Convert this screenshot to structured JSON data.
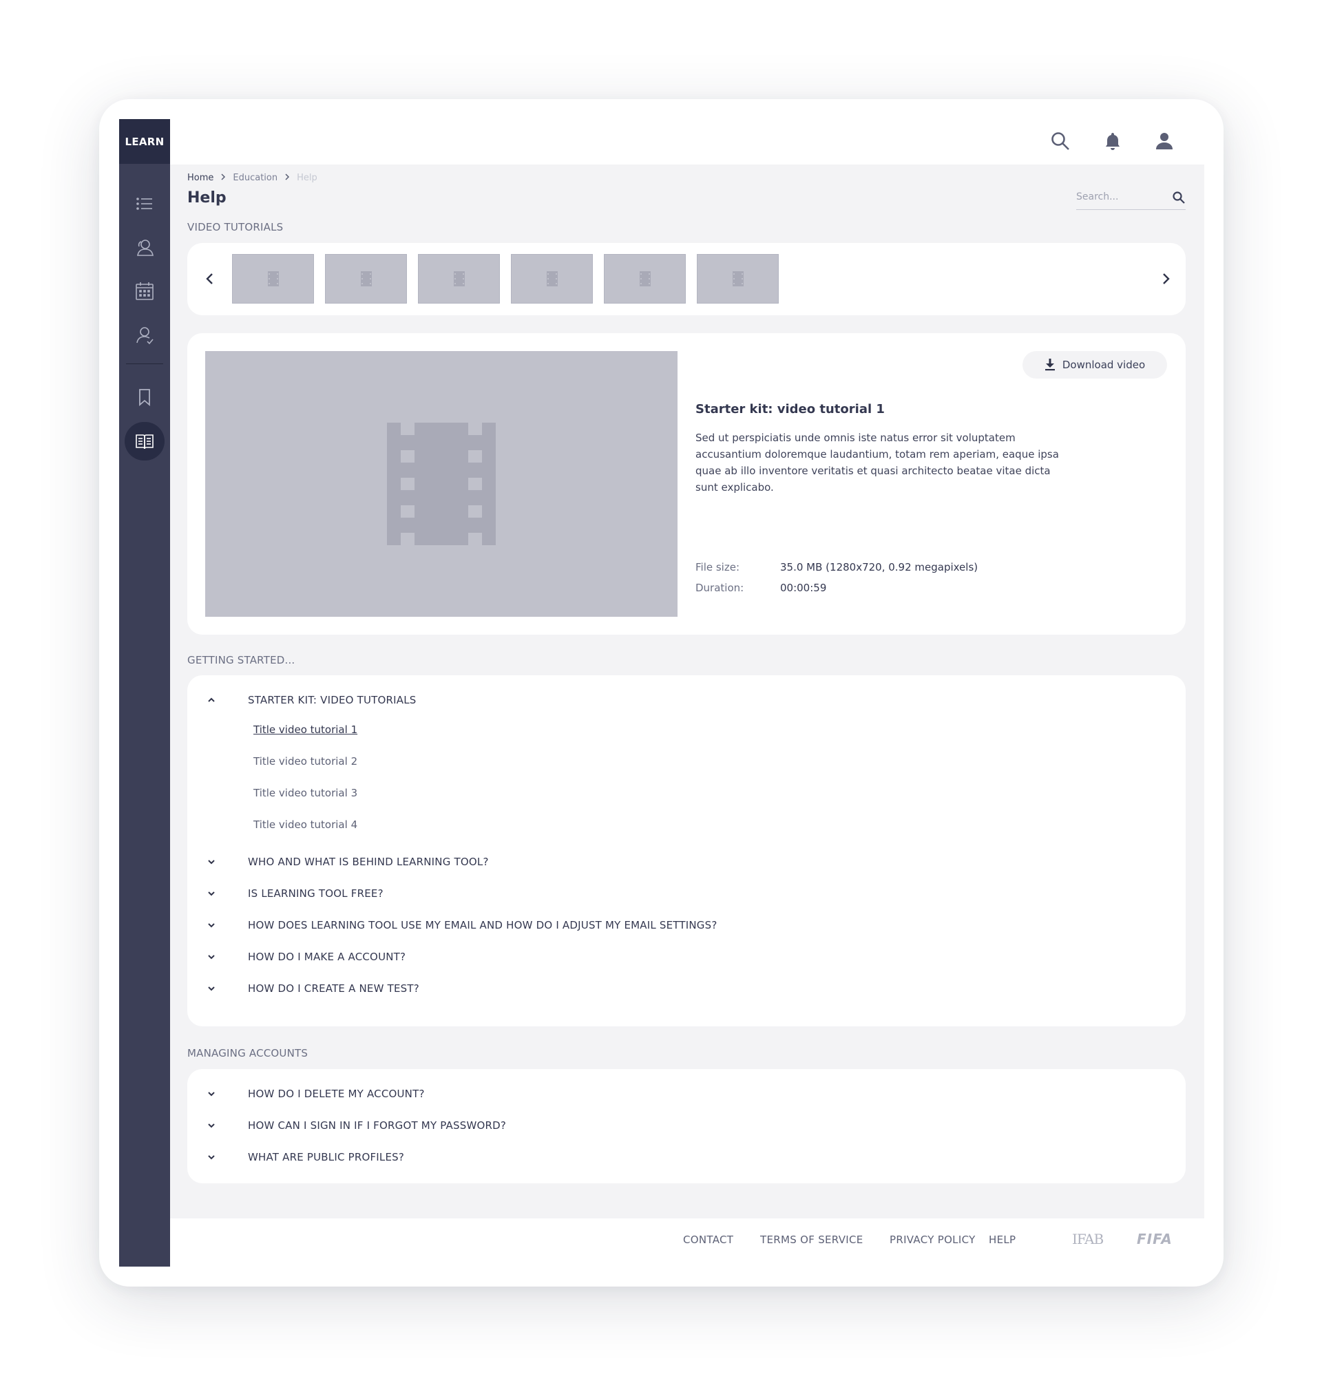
{
  "app": {
    "brand": "LEARN"
  },
  "sidebar": {
    "icons": [
      "list-icon",
      "users-icon",
      "calendar-icon",
      "user-icon",
      "bookmark-icon",
      "book-icon"
    ],
    "active": "book-icon"
  },
  "topbar": {
    "icons": [
      "search-icon",
      "bell-icon",
      "profile-icon"
    ]
  },
  "breadcrumb": {
    "items": [
      "Home",
      "Education",
      "Help"
    ]
  },
  "page": {
    "title": "Help"
  },
  "search": {
    "placeholder": "Search..."
  },
  "video_tutorials": {
    "label": "VIDEO TUTORIALS",
    "thumbnail_count": 6
  },
  "video": {
    "download_label": "Download video",
    "title": "Starter kit: video tutorial 1",
    "description": "Sed ut perspiciatis unde omnis iste natus error sit voluptatem accusantium doloremque laudantium, totam rem aperiam, eaque ipsa quae ab illo inventore veritatis et quasi architecto beatae vitae dicta sunt explicabo.",
    "file_size_label": "File size:",
    "file_size": "35.0 MB (1280x720, 0.92 megapixels)",
    "duration_label": "Duration:",
    "duration": "00:00:59"
  },
  "getting_started": {
    "label": "GETTING STARTED...",
    "expanded": {
      "title": "STARTER KIT: VIDEO TUTORIALS",
      "items": [
        "Title video tutorial 1",
        "Title video tutorial 2",
        "Title video tutorial 3",
        "Title video tutorial 4"
      ]
    },
    "questions": [
      "WHO AND WHAT IS BEHIND LEARNING TOOL?",
      "IS LEARNING TOOL FREE?",
      "HOW DOES LEARNING TOOL USE MY EMAIL AND HOW DO I ADJUST MY EMAIL SETTINGS?",
      "HOW DO I MAKE A ACCOUNT?",
      "HOW DO I CREATE A NEW TEST?"
    ]
  },
  "managing_accounts": {
    "label": "MANAGING ACCOUNTS",
    "questions": [
      "HOW DO I DELETE MY ACCOUNT?",
      "HOW CAN I SIGN IN IF I FORGOT MY PASSWORD?",
      "WHAT ARE PUBLIC PROFILES?"
    ]
  },
  "footer": {
    "links": [
      "CONTACT",
      "TERMS OF SERVICE",
      "PRIVACY POLICY",
      "HELP"
    ],
    "logos": [
      "IFAB",
      "FIFA"
    ]
  },
  "colors": {
    "sidebar": "#3c3f57",
    "sidebar_dark": "#282c44",
    "background": "#f3f3f5",
    "placeholder": "#c0c1cb",
    "text": "#343850"
  }
}
